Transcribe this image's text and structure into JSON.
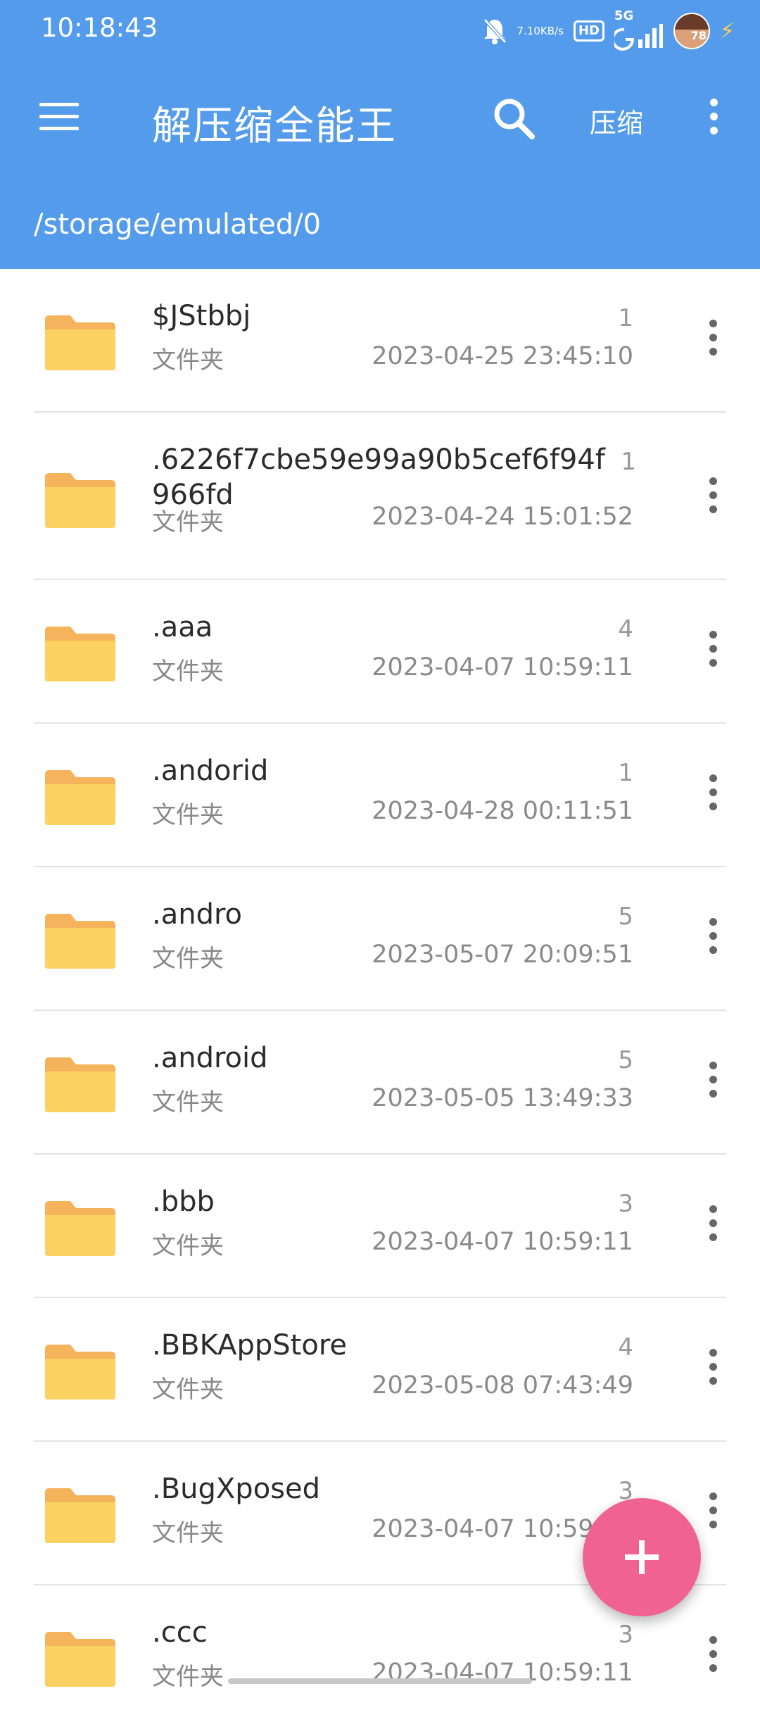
{
  "status_bar": {
    "time": "10:18:43",
    "net_speed": "7.10",
    "net_unit": "KB/s",
    "hd": "HD",
    "signal": "5G",
    "avatar_badge": "78"
  },
  "appbar": {
    "title": "解压缩全能王",
    "compress_label": "压缩",
    "path": "/storage/emulated/0",
    "color": "#549CEB"
  },
  "files": [
    {
      "name": "$JStbbj",
      "type": "文件夹",
      "count": "1",
      "date": "2023-04-25 23:45:10"
    },
    {
      "name": ".6226f7cbe59e99a90b5cef6f94f966fd",
      "type": "文件夹",
      "count": "1",
      "date": "2023-04-24 15:01:52"
    },
    {
      "name": ".aaa",
      "type": "文件夹",
      "count": "4",
      "date": "2023-04-07 10:59:11"
    },
    {
      "name": ".andorid",
      "type": "文件夹",
      "count": "1",
      "date": "2023-04-28 00:11:51"
    },
    {
      "name": ".andro",
      "type": "文件夹",
      "count": "5",
      "date": "2023-05-07 20:09:51"
    },
    {
      "name": ".android",
      "type": "文件夹",
      "count": "5",
      "date": "2023-05-05 13:49:33"
    },
    {
      "name": ".bbb",
      "type": "文件夹",
      "count": "3",
      "date": "2023-04-07 10:59:11"
    },
    {
      "name": ".BBKAppStore",
      "type": "文件夹",
      "count": "4",
      "date": "2023-05-08 07:43:49"
    },
    {
      "name": ".BugXposed",
      "type": "文件夹",
      "count": "3",
      "date": "2023-04-07 10:59:11"
    },
    {
      "name": ".ccc",
      "type": "文件夹",
      "count": "3",
      "date": "2023-04-07 10:59:11"
    }
  ],
  "icons": {
    "menu": "menu-icon",
    "search": "search-icon",
    "overflow": "more-vert-icon",
    "folder": "folder-icon",
    "fab": "add-icon"
  },
  "colors": {
    "fab": "#F06292",
    "folder": "#FBD262"
  }
}
